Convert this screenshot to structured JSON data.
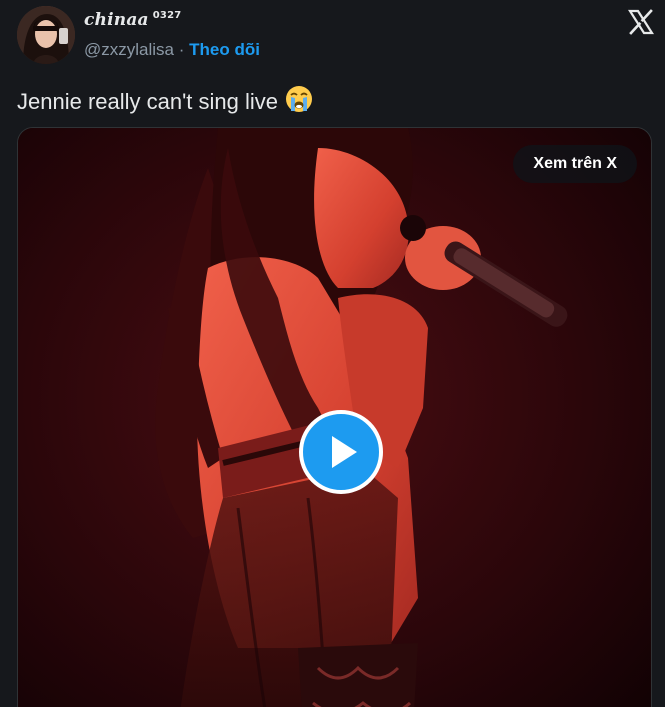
{
  "author": {
    "display_name": "chinaa",
    "display_name_suffix": "0327",
    "handle": "@zxzylalisa",
    "separator": "·",
    "follow_label": "Theo dõi"
  },
  "tweet": {
    "text": "Jennie really can't sing live",
    "emoji": "loudly-crying-face"
  },
  "media": {
    "view_on_x_label": "Xem trên X",
    "type": "video"
  },
  "icons": {
    "x_logo": "x-logo-icon",
    "play": "play-icon"
  },
  "colors": {
    "background": "#16181c",
    "text": "#e7e9ea",
    "muted": "#8b98a5",
    "accent": "#1d9bf0"
  }
}
